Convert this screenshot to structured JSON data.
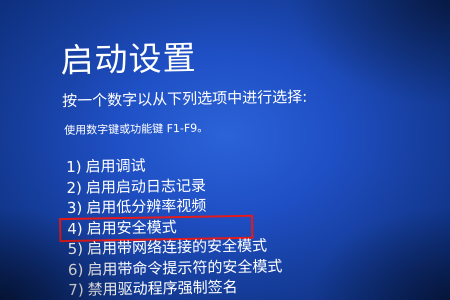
{
  "screen": {
    "title": "启动设置",
    "instruction": "按一个数字以从下列选项中进行选择:",
    "hint": "使用数字键或功能键 F1-F9。"
  },
  "options": [
    {
      "num": "1)",
      "label": "启用调试"
    },
    {
      "num": "2)",
      "label": "启用启动日志记录"
    },
    {
      "num": "3)",
      "label": "启用低分辨率视频"
    },
    {
      "num": "4)",
      "label": "启用安全模式"
    },
    {
      "num": "5)",
      "label": "启用带网络连接的安全模式"
    },
    {
      "num": "6)",
      "label": "启用带命令提示符的安全模式"
    },
    {
      "num": "7)",
      "label": "禁用驱动程序强制签名"
    }
  ],
  "highlight_option_index": 3,
  "colors": {
    "background": "#1f4fc4",
    "text": "#ffffff",
    "highlight_border": "#e51a1a"
  }
}
